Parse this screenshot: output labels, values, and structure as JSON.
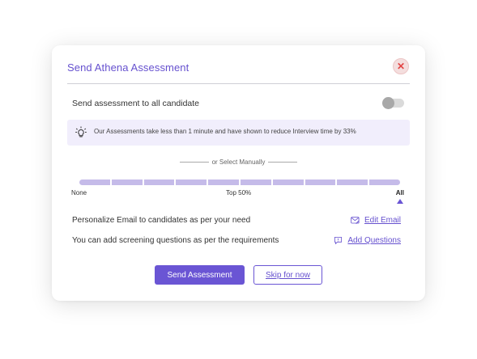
{
  "modal": {
    "title": "Send Athena Assessment",
    "close_glyph": "✕"
  },
  "send_all": {
    "label": "Send assessment to all candidate",
    "toggle_on": false
  },
  "tip": {
    "icon": "lightbulb-icon",
    "text": "Our Assessments take less than 1 minute and have shown to reduce Interview time by 33%"
  },
  "manual": {
    "label": "or Select Manually",
    "segments": 10,
    "labels": {
      "none": "None",
      "mid": "Top 50%",
      "all": "All"
    },
    "selected": "All"
  },
  "email": {
    "text": "Personalize Email to candidates as per your need",
    "link": "Edit Email",
    "icon": "edit-email-icon"
  },
  "questions": {
    "text": "You can add screening questions as per the requirements",
    "link": "Add Questions",
    "icon": "chat-bubble-icon"
  },
  "actions": {
    "primary": "Send Assessment",
    "secondary": "Skip for now"
  },
  "colors": {
    "accent": "#6a55d4",
    "close_red": "#e24545",
    "tip_bg": "#f1eefc",
    "slider": "#c5bbe9"
  }
}
